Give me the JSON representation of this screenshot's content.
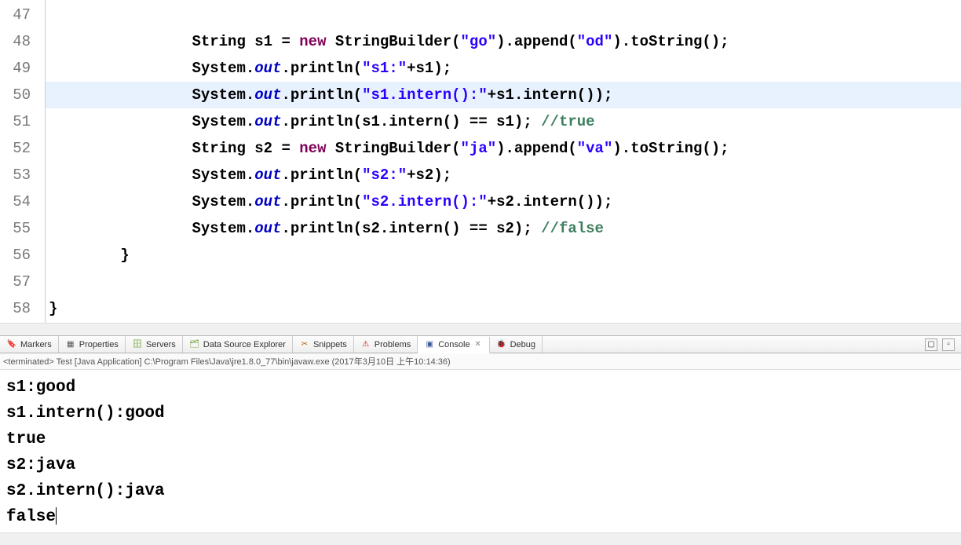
{
  "gutterStart": 47,
  "highlightedLine": 50,
  "code": [
    {
      "num": 47,
      "tokens": []
    },
    {
      "num": 48,
      "indent": "                ",
      "tokens": [
        {
          "t": "plain",
          "v": "String s1 = "
        },
        {
          "t": "kw",
          "v": "new"
        },
        {
          "t": "plain",
          "v": " StringBuilder("
        },
        {
          "t": "str",
          "v": "\"go\""
        },
        {
          "t": "plain",
          "v": ").append("
        },
        {
          "t": "str",
          "v": "\"od\""
        },
        {
          "t": "plain",
          "v": ").toString();"
        }
      ]
    },
    {
      "num": 49,
      "indent": "                ",
      "tokens": [
        {
          "t": "plain",
          "v": "System."
        },
        {
          "t": "fld",
          "v": "out"
        },
        {
          "t": "plain",
          "v": ".println("
        },
        {
          "t": "str",
          "v": "\"s1:\""
        },
        {
          "t": "plain",
          "v": "+s1);"
        }
      ]
    },
    {
      "num": 50,
      "indent": "                ",
      "hl": true,
      "tokens": [
        {
          "t": "plain",
          "v": "System."
        },
        {
          "t": "fld",
          "v": "out"
        },
        {
          "t": "plain",
          "v": ".println("
        },
        {
          "t": "str",
          "v": "\"s1.intern():\""
        },
        {
          "t": "plain",
          "v": "+s1.intern());"
        }
      ]
    },
    {
      "num": 51,
      "indent": "                ",
      "tokens": [
        {
          "t": "plain",
          "v": "System."
        },
        {
          "t": "fld",
          "v": "out"
        },
        {
          "t": "plain",
          "v": ".println(s1.intern() == s1); "
        },
        {
          "t": "cmt",
          "v": "//true"
        }
      ]
    },
    {
      "num": 52,
      "indent": "                ",
      "tokens": [
        {
          "t": "plain",
          "v": "String s2 = "
        },
        {
          "t": "kw",
          "v": "new"
        },
        {
          "t": "plain",
          "v": " StringBuilder("
        },
        {
          "t": "str",
          "v": "\"ja\""
        },
        {
          "t": "plain",
          "v": ").append("
        },
        {
          "t": "str",
          "v": "\"va\""
        },
        {
          "t": "plain",
          "v": ").toString();"
        }
      ]
    },
    {
      "num": 53,
      "indent": "                ",
      "tokens": [
        {
          "t": "plain",
          "v": "System."
        },
        {
          "t": "fld",
          "v": "out"
        },
        {
          "t": "plain",
          "v": ".println("
        },
        {
          "t": "str",
          "v": "\"s2:\""
        },
        {
          "t": "plain",
          "v": "+s2);"
        }
      ]
    },
    {
      "num": 54,
      "indent": "                ",
      "tokens": [
        {
          "t": "plain",
          "v": "System."
        },
        {
          "t": "fld",
          "v": "out"
        },
        {
          "t": "plain",
          "v": ".println("
        },
        {
          "t": "str",
          "v": "\"s2.intern():\""
        },
        {
          "t": "plain",
          "v": "+s2.intern());"
        }
      ]
    },
    {
      "num": 55,
      "indent": "                ",
      "tokens": [
        {
          "t": "plain",
          "v": "System."
        },
        {
          "t": "fld",
          "v": "out"
        },
        {
          "t": "plain",
          "v": ".println(s2.intern() == s2); "
        },
        {
          "t": "cmt",
          "v": "//false"
        }
      ]
    },
    {
      "num": 56,
      "indent": "        ",
      "tokens": [
        {
          "t": "plain",
          "v": "}"
        }
      ]
    },
    {
      "num": 57,
      "tokens": []
    },
    {
      "num": 58,
      "indent": "",
      "tokens": [
        {
          "t": "plain",
          "v": "}"
        }
      ]
    }
  ],
  "tabs": [
    {
      "icon": "🔖",
      "label": "Markers",
      "color": "#c97a00"
    },
    {
      "icon": "▦",
      "label": "Properties",
      "color": "#555"
    },
    {
      "icon": "🗄",
      "label": "Servers",
      "color": "#6a9d2f"
    },
    {
      "icon": "🗂",
      "label": "Data Source Explorer",
      "color": "#6a9d2f"
    },
    {
      "icon": "✂",
      "label": "Snippets",
      "color": "#b05e00"
    },
    {
      "icon": "⚠",
      "label": "Problems",
      "color": "#c00"
    },
    {
      "icon": "▣",
      "label": "Console",
      "color": "#3b5998",
      "active": true,
      "closable": true
    },
    {
      "icon": "🐞",
      "label": "Debug",
      "color": "#6a9d2f"
    }
  ],
  "consoleHeader": "<terminated> Test [Java Application] C:\\Program Files\\Java\\jre1.8.0_77\\bin\\javaw.exe (2017年3月10日 上午10:14:36)",
  "consoleLines": [
    "s1:good",
    "s1.intern():good",
    "true",
    "s2:java",
    "s2.intern():java",
    "false"
  ],
  "toolbarRight": {
    "btn1": "▢",
    "btn2": "▫"
  }
}
